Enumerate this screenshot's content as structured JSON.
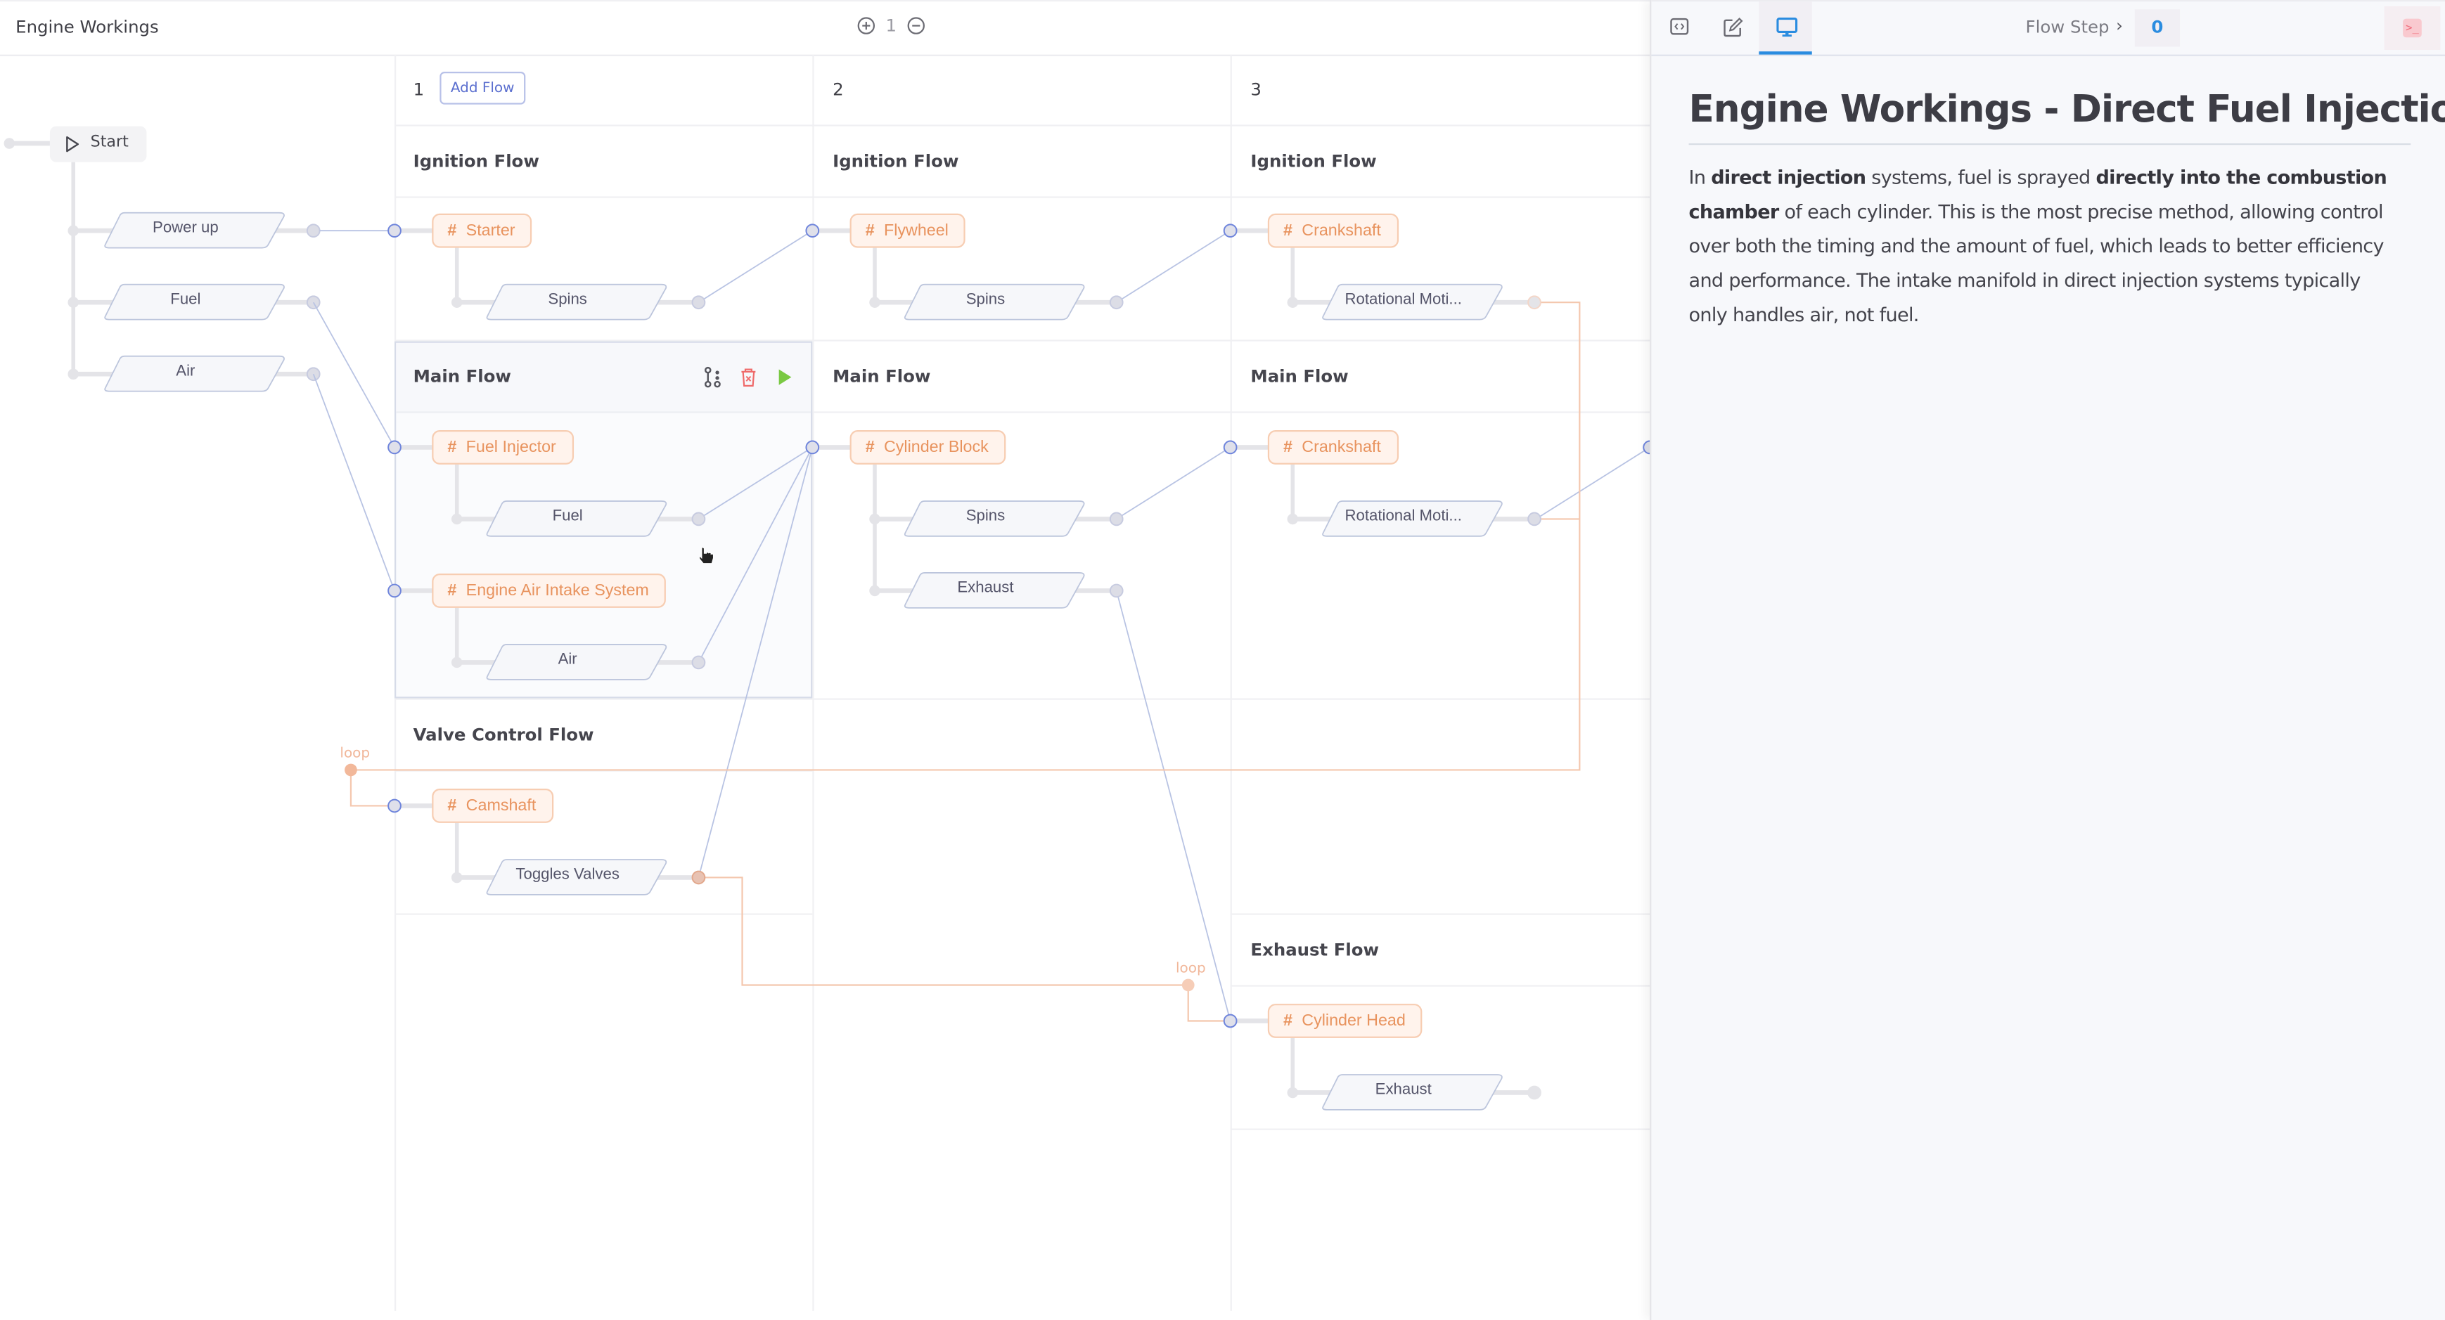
{
  "header": {
    "title": "Engine Workings",
    "zoom_in_icon": "plus-circle-icon",
    "zoom_level": "1",
    "zoom_out_icon": "minus-circle-icon"
  },
  "canvas": {
    "start_label": "Start",
    "start_icon": "play-outline-icon",
    "inputs": [
      "Power up",
      "Fuel",
      "Air"
    ],
    "columns": [
      {
        "number": "1",
        "add_flow_label": "Add Flow"
      },
      {
        "number": "2"
      },
      {
        "number": "3"
      }
    ],
    "flows": {
      "c1_ignition": {
        "title": "Ignition Flow",
        "step": "Starter",
        "outputs": [
          "Spins"
        ]
      },
      "c1_main": {
        "title": "Main Flow",
        "steps": [
          {
            "name": "Fuel Injector",
            "outputs": [
              "Fuel"
            ]
          },
          {
            "name": "Engine Air Intake System",
            "outputs": [
              "Air"
            ]
          }
        ],
        "actions": [
          "branch-icon",
          "delete-icon",
          "run-icon"
        ]
      },
      "c1_valve": {
        "title": "Valve Control Flow",
        "step": "Camshaft",
        "outputs": [
          "Toggles Valves"
        ]
      },
      "c2_ignition": {
        "title": "Ignition Flow",
        "step": "Flywheel",
        "outputs": [
          "Spins"
        ]
      },
      "c2_main": {
        "title": "Main Flow",
        "step": "Cylinder Block",
        "outputs": [
          "Spins",
          "Exhaust"
        ]
      },
      "c3_ignition": {
        "title": "Ignition Flow",
        "step": "Crankshaft",
        "outputs": [
          "Rotational Moti..."
        ]
      },
      "c3_main": {
        "title": "Main Flow",
        "step": "Crankshaft",
        "outputs": [
          "Rotational Moti..."
        ]
      },
      "c3_exhaust": {
        "title": "Exhaust Flow",
        "step": "Cylinder Head",
        "outputs": [
          "Exhaust"
        ]
      }
    },
    "step_hash_glyph": "#",
    "loop_labels": [
      "loop",
      "loop"
    ]
  },
  "panel": {
    "tabs": [
      {
        "icon": "code-icon",
        "active": false
      },
      {
        "icon": "edit-icon",
        "active": false
      },
      {
        "icon": "monitor-icon",
        "active": true
      }
    ],
    "breadcrumb_label": "Flow Step",
    "breadcrumb_value": "0",
    "terminal_icon": "terminal-icon",
    "doc_title": "Engine Workings - Direct Fuel Injection",
    "doc_body": [
      {
        "t": "In ",
        "b": false
      },
      {
        "t": "direct injection",
        "b": true
      },
      {
        "t": " systems, fuel is sprayed ",
        "b": false
      },
      {
        "t": "directly into the combustion chamber",
        "b": true
      },
      {
        "t": " of each cylinder. This is the most precise method, allowing control over both the timing and the amount of fuel, which leads to better efficiency and performance. The intake manifold in direct injection systems typically only handles air, not fuel.",
        "b": false
      }
    ]
  },
  "colors": {
    "accent": "#2a8ce0",
    "step_text": "#e8935e",
    "step_bg": "#fff3ec",
    "wire": "#b8c3e3",
    "loop_wire": "#f4c7ae",
    "run_green": "#7ac943",
    "delete_red": "#ef6a6a"
  }
}
